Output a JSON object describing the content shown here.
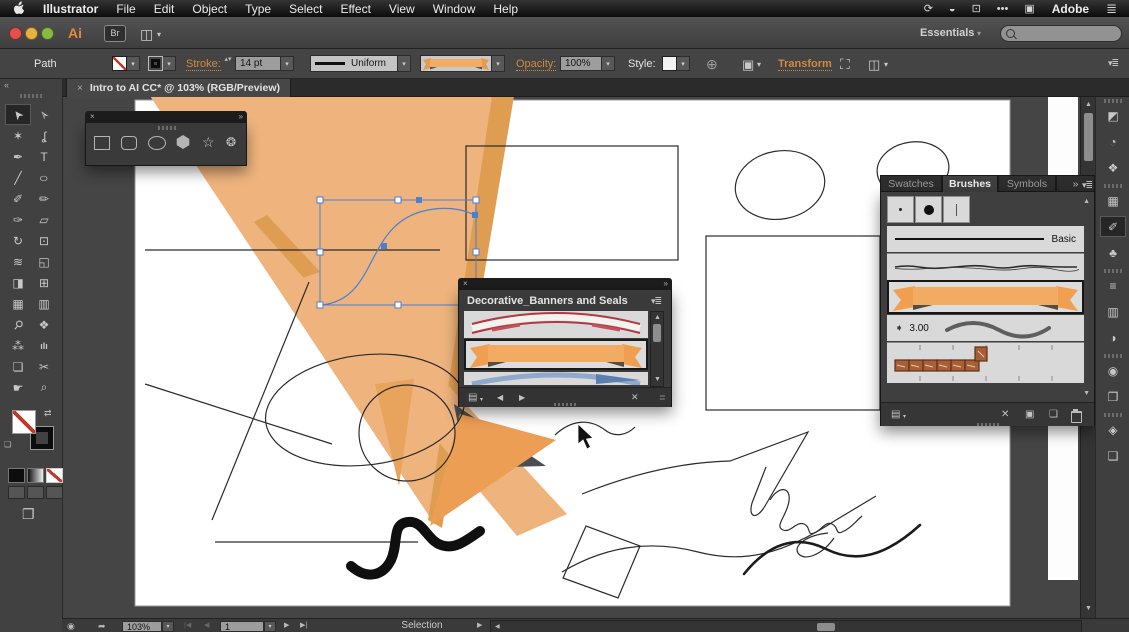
{
  "colors": {
    "orange_fill": "#EFB47D",
    "orange_dark": "#DF9D52",
    "selection_blue": "#4A7FD4",
    "link_orange": "#CF8A3E"
  },
  "menu_bar": {
    "items": [
      "Illustrator",
      "File",
      "Edit",
      "Object",
      "Type",
      "Select",
      "Effect",
      "View",
      "Window",
      "Help"
    ],
    "adobe_label": "Adobe",
    "right_icons": [
      {
        "n": "sync-icon",
        "g": "⟳"
      },
      {
        "n": "creative-cloud-icon",
        "g": "◒"
      },
      {
        "n": "screen-record-icon",
        "g": "⊡"
      },
      {
        "n": "more-icon",
        "g": "•••"
      },
      {
        "n": "display-icon",
        "g": "▣"
      },
      {
        "n": "menu-list-icon",
        "g": "≣"
      }
    ]
  },
  "app_bar": {
    "ai_logo": "Ai",
    "bridge_label": "Br",
    "layout_icon": "◫",
    "layout_arrow": "▾",
    "workspace_label": "Essentials",
    "workspace_arrow": "▾"
  },
  "control_bar": {
    "object_type": "Path",
    "stroke_label": "Stroke:",
    "stroke_value": "14 pt",
    "width_profile": "Uniform",
    "opacity_label": "Opacity:",
    "opacity_value": "100%",
    "style_label": "Style:",
    "transform_label": "Transform",
    "stepper": "▴▾",
    "globe_icon": "⊕",
    "select_similar_icon": "▣",
    "align_icon": "⛶",
    "isolate_icon": "◫",
    "panel_menu_icon": "▾≣"
  },
  "doc_tab": {
    "close": "×",
    "title": "Intro to AI CC* @ 103% (RGB/Preview)"
  },
  "toolbar": {
    "collapse": "«",
    "tools": [
      {
        "n": "selection-tool",
        "g": "➤"
      },
      {
        "n": "direct-selection-tool",
        "g": "➢"
      },
      {
        "n": "magic-wand-tool",
        "g": "✶"
      },
      {
        "n": "lasso-tool",
        "g": "ʆ"
      },
      {
        "n": "pen-tool",
        "g": "✒"
      },
      {
        "n": "type-tool",
        "g": "T"
      },
      {
        "n": "line-segment-tool",
        "g": "╱"
      },
      {
        "n": "ellipse-tool",
        "g": "○"
      },
      {
        "n": "paintbrush-tool",
        "g": "✐"
      },
      {
        "n": "pencil-tool",
        "g": "✏"
      },
      {
        "n": "blob-brush-tool",
        "g": "✑"
      },
      {
        "n": "eraser-tool",
        "g": "▱"
      },
      {
        "n": "rotate-tool",
        "g": "↻"
      },
      {
        "n": "scale-tool",
        "g": "⊡"
      },
      {
        "n": "width-tool",
        "g": "≋"
      },
      {
        "n": "free-transform-tool",
        "g": "◱"
      },
      {
        "n": "shape-builder-tool",
        "g": "◨"
      },
      {
        "n": "perspective-grid-tool",
        "g": "⊞"
      },
      {
        "n": "mesh-tool",
        "g": "▦"
      },
      {
        "n": "gradient-tool",
        "g": "▥"
      },
      {
        "n": "eyedropper-tool",
        "g": "⚲"
      },
      {
        "n": "blend-tool",
        "g": "❖"
      },
      {
        "n": "symbol-sprayer-tool",
        "g": "⁂"
      },
      {
        "n": "column-graph-tool",
        "g": "ılı"
      },
      {
        "n": "artboard-tool",
        "g": "❏"
      },
      {
        "n": "slice-tool",
        "g": "✂"
      },
      {
        "n": "hand-tool",
        "g": "☛"
      },
      {
        "n": "zoom-tool",
        "g": "⌕"
      }
    ]
  },
  "shapes_panel": {
    "close": "×",
    "collapse": "»",
    "star_glyph": "☆",
    "flare_glyph": "❂"
  },
  "banners_panel": {
    "close": "×",
    "collapse": "»",
    "title": "Decorative_Banners and Seals",
    "menu_icon": "▾≣",
    "library_icon": "▤",
    "library_arrow": "▾",
    "prev": "◀",
    "next": "▶",
    "remove": "✕",
    "grip": "≣"
  },
  "brushes_panel": {
    "tabs": [
      "Swatches",
      "Brushes",
      "Symbols"
    ],
    "expand": "»",
    "menu_icon": "▾≣",
    "basic_label": "Basic",
    "width_icon": "➧",
    "width_value": "3.00",
    "library_icon": "▤",
    "library_arrow": "▾",
    "remove": "✕",
    "options_icon": "▣",
    "new_icon": "❏",
    "scroll_up": "▲",
    "scroll_down": "▼"
  },
  "dock": [
    {
      "n": "color-panel-icon",
      "g": "◩"
    },
    {
      "n": "color-guide-panel-icon",
      "g": "◔"
    },
    {
      "n": "color-themes-panel-icon",
      "g": "❖"
    },
    {
      "n": "swatches-panel-icon",
      "g": "▦"
    },
    {
      "n": "brushes-panel-icon",
      "g": "✐"
    },
    {
      "n": "symbols-panel-icon",
      "g": "♣"
    },
    {
      "n": "stroke-panel-icon",
      "g": "≡"
    },
    {
      "n": "gradient-panel-icon",
      "g": "▥"
    },
    {
      "n": "transparency-panel-icon",
      "g": "◑"
    },
    {
      "n": "appearance-panel-icon",
      "g": "◉"
    },
    {
      "n": "graphic-styles-panel-icon",
      "g": "❐"
    },
    {
      "n": "layers-panel-icon",
      "g": "◈"
    },
    {
      "n": "artboards-panel-icon",
      "g": "❑"
    }
  ],
  "status_bar": {
    "view_icon": "◉",
    "export_icon": "➦",
    "zoom": "103%",
    "first": "|◀",
    "prev": "◀",
    "artboard": "1",
    "next": "▶",
    "last": "▶|",
    "mode": "Selection",
    "divider": "▶",
    "scroll_left": "◀"
  },
  "scrollbars": {
    "up": "▲",
    "down": "▼"
  }
}
